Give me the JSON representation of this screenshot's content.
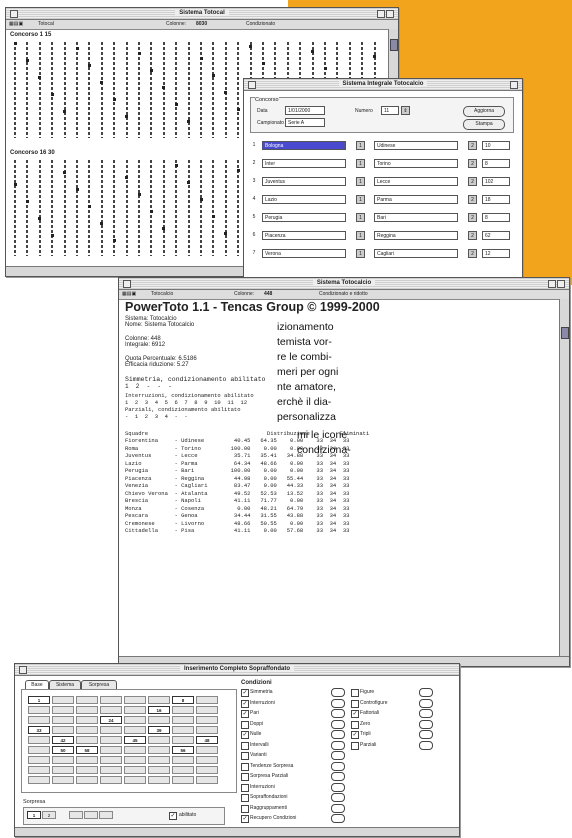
{
  "window1": {
    "title": "Sistema Totocal",
    "toolbar": {
      "label1": "Totocal",
      "colonne_label": "Colonne:",
      "colonne_value": "8030",
      "condizionato": "Condizionato"
    },
    "section1": "Concorso 1 15",
    "section2": "Concorso 16 30"
  },
  "window2": {
    "title": "Sistema Integrale Totocalcio",
    "group_label": "Concorso",
    "data_label": "Data",
    "data_value": "1/01/2000",
    "numero_label": "Numero",
    "numero_value": "11",
    "campionato_label": "Campionato",
    "campionato_value": "Serie A",
    "btn_aggiorna": "Aggiorna",
    "btn_stampa": "Stampa",
    "rows": [
      {
        "n": "1",
        "home": "Bologna",
        "away": "Udinese",
        "val": "10"
      },
      {
        "n": "2",
        "home": "Inter",
        "away": "Torino",
        "val": "8"
      },
      {
        "n": "3",
        "home": "Juventus",
        "away": "Lecce",
        "val": "102"
      },
      {
        "n": "4",
        "home": "Lazio",
        "away": "Parma",
        "val": "18"
      },
      {
        "n": "5",
        "home": "Perugia",
        "away": "Bari",
        "val": "8"
      },
      {
        "n": "6",
        "home": "Piacenza",
        "away": "Reggina",
        "val": "62"
      },
      {
        "n": "7",
        "home": "Verona",
        "away": "Cagliari",
        "val": "12"
      }
    ]
  },
  "window3": {
    "title": "Sistema Totocalcio",
    "toolbar": {
      "label1": "Totocalcio",
      "colonne_label": "Colonne:",
      "colonne_value": "448",
      "condizionato": "Condizionato e ridotto"
    },
    "heading": "PowerToto 1.1 - Tencas Group © 1999-2000",
    "sistema_line": "Sistema: Totocalcio",
    "nome_line": "Nome: Sistema Totocalcio",
    "colonne_line": "Colonne: 448",
    "integrale_line": "Integrale: 6912",
    "quota_line": "Quota Percentuale: 6.5186",
    "riduzione_line": "Efficacia riduzione: 5.27",
    "cond1": "Simmetria, condizionamento abilitato",
    "cond1_vals": "1  2  -  -  -",
    "cond2": "Interruzioni, condizionamento abilitato",
    "cond2_vals": "1  2  3  4  5  6  7  8  9  10  11  12",
    "cond3": "Parziali, condizionamento abilitato",
    "cond3_vals": "-  1  2  3  4  -  -",
    "table_header": "Squadre                                    Distribuzione         Eliminati",
    "table_rows": [
      "Fiorentina     - Udinese         40.45   64.35    0.00    33  34  33",
      "Roma           - Torino         100.00    0.00    0.00    33  34  33",
      "Juventus       - Lecce           35.71   35.41   34.88    33  34  33",
      "Lazio          - Parma           64.34   48.66    0.00    33  34  33",
      "Perugia        - Bari           100.00    0.00    0.00    33  34  33",
      "Piacenza       - Reggina         44.98    0.00   55.44    33  34  33",
      "Venezia        - Cagliari        83.47    0.00   44.33    33  34  33",
      "Chievo Verona  - Atalanta        49.52   52.53   13.52    33  34  33",
      "Brescia        - Napoli          41.11   71.77    0.00    33  34  33",
      "Monza          - Cosenza          0.00   48.21   64.79    33  34  33",
      "Pescara        - Genoa           34.44   31.55   43.88    33  34  33",
      "Cremonese      - Livorno         48.66   50.55    0.00    33  34  33",
      "Cittadella     - Pisa            41.11    0.00   57.68    33  34  33"
    ]
  },
  "window4": {
    "title": "Inserimento Completo Sopraffondato",
    "tabs": [
      "Base",
      "Sistema",
      "Sorpresa"
    ],
    "grid": [
      [
        "1",
        "",
        "",
        "",
        "",
        "",
        "8",
        ""
      ],
      [
        "",
        "",
        "",
        "",
        "",
        "16",
        "",
        ""
      ],
      [
        "",
        "",
        "",
        "24",
        "",
        "",
        "",
        ""
      ],
      [
        "33",
        "",
        "",
        "",
        "",
        "39",
        "",
        ""
      ],
      [
        "",
        "42",
        "",
        "",
        "45",
        "",
        "",
        "48"
      ],
      [
        "",
        "50",
        "58",
        "",
        "",
        "",
        "56",
        ""
      ],
      [
        "",
        "",
        "",
        "",
        "",
        "",
        "",
        ""
      ],
      [
        "",
        "",
        "",
        "",
        "",
        "",
        "",
        ""
      ],
      [
        "",
        "",
        "",
        "",
        "",
        "",
        "",
        ""
      ]
    ],
    "sorpresa_label": "Sorpresa",
    "sorpresa_checkbox_label": "abilitato",
    "conditions_label": "Condizioni",
    "conditions_left": [
      {
        "label": "Simmetria",
        "checked": true
      },
      {
        "label": "Interruzioni",
        "checked": true
      },
      {
        "label": "Pari",
        "checked": true
      },
      {
        "label": "Doppi",
        "checked": false
      },
      {
        "label": "Nulle",
        "checked": true
      },
      {
        "label": "Intervalli",
        "checked": false
      },
      {
        "label": "Varianti",
        "checked": false
      },
      {
        "label": "Tendenze Sorpresa",
        "checked": false
      },
      {
        "label": "Sorpresa Parziali",
        "checked": false
      },
      {
        "label": "Interruzioni",
        "checked": false
      },
      {
        "label": "Sopraffondazioni",
        "checked": false
      },
      {
        "label": "Raggruppamenti",
        "checked": false
      },
      {
        "label": "Recupero Condizioni",
        "checked": true
      }
    ],
    "conditions_right": [
      {
        "label": "Figure",
        "checked": false
      },
      {
        "label": "Controfigure",
        "checked": false
      },
      {
        "label": "Fattoriali",
        "checked": true
      },
      {
        "label": "Zero",
        "checked": false
      },
      {
        "label": "Tripli",
        "checked": true
      },
      {
        "label": "Parziali",
        "checked": false
      }
    ]
  },
  "article": {
    "lines_a": [
      "izionamento",
      "temista vor-",
      "re le combi-",
      "meri per ogni",
      "nte amatore,",
      "erchè il dia-",
      "personalizza"
    ],
    "lines_b": [
      "mi le icone",
      "condiziona-"
    ]
  }
}
